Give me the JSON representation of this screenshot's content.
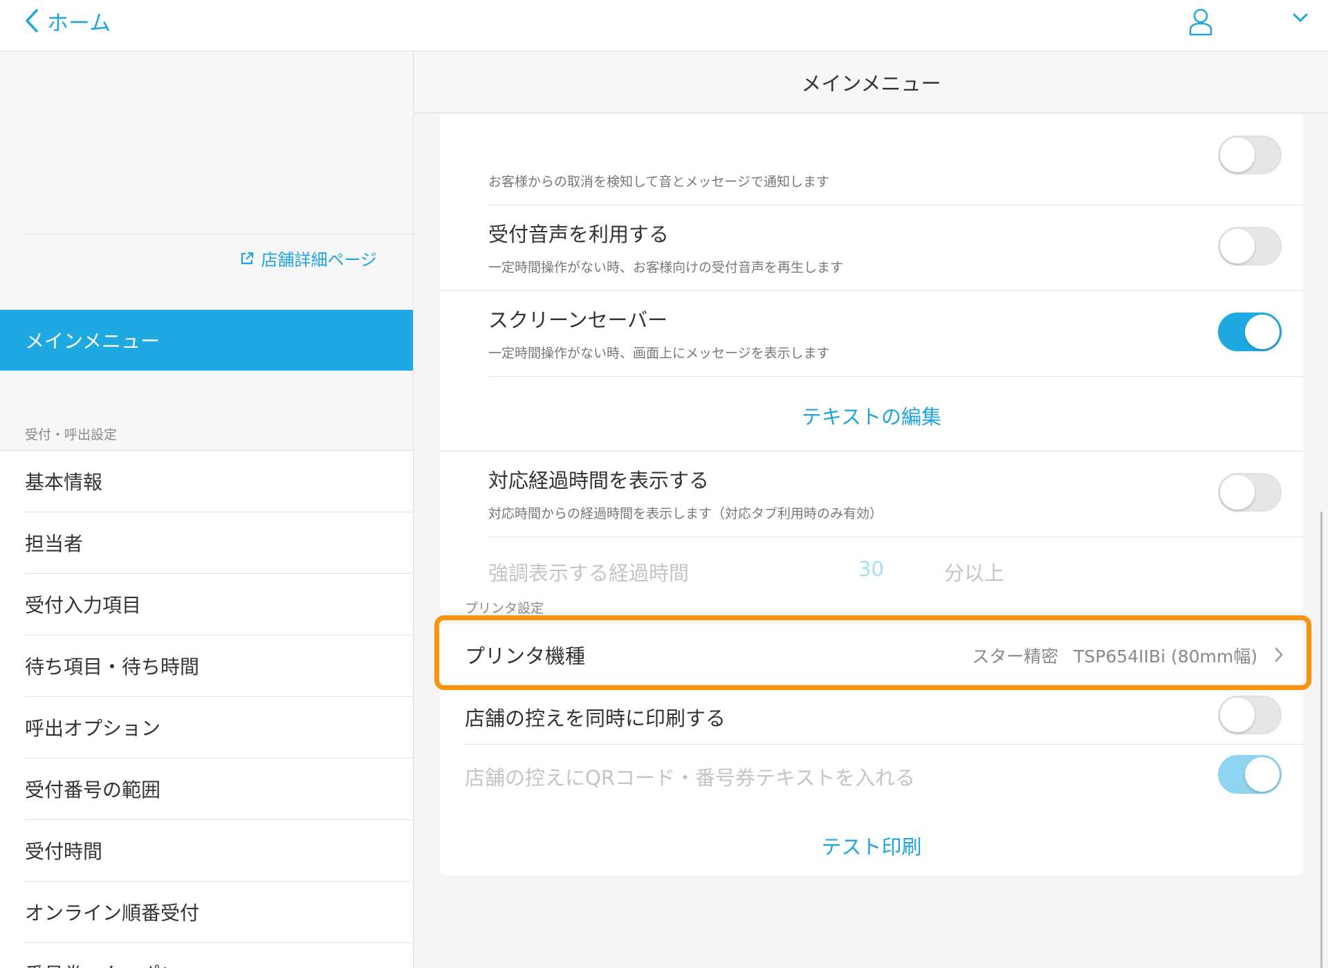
{
  "topbar": {
    "back_label": "ホーム"
  },
  "sidebar": {
    "store_link": "店舗詳細ページ",
    "active_item": "メインメニュー",
    "section_label": "受付・呼出設定",
    "items": [
      {
        "label": "基本情報"
      },
      {
        "label": "担当者"
      },
      {
        "label": "受付入力項目"
      },
      {
        "label": "待ち項目・待ち時間"
      },
      {
        "label": "呼出オプション"
      },
      {
        "label": "受付番号の範囲"
      },
      {
        "label": "受付時間"
      },
      {
        "label": "オンライン順番受付"
      },
      {
        "label": "番号券・クーポン"
      }
    ]
  },
  "main": {
    "header_title": "メインメニュー",
    "cancel_notice": {
      "subtitle": "お客様からの取消を検知して音とメッセージで通知します"
    },
    "reception_voice": {
      "title": "受付音声を利用する",
      "subtitle": "一定時間操作がない時、お客様向けの受付音声を再生します",
      "enabled": false
    },
    "screensaver": {
      "title": "スクリーンセーバー",
      "subtitle": "一定時間操作がない時、画面上にメッセージを表示します",
      "enabled": true
    },
    "edit_text_label": "テキストの編集",
    "elapsed_time": {
      "title": "対応経過時間を表示する",
      "subtitle": "対応時間からの経過時間を表示します（対応タブ利用時のみ有効）",
      "enabled": false
    },
    "highlight_elapsed": {
      "label": "強調表示する経過時間",
      "value": "30",
      "unit": "分以上"
    },
    "printer_section_label": "プリンタ設定",
    "printer_model": {
      "label": "プリンタ機種",
      "maker": "スター精密",
      "model": "TSP654IIBi (80mm幅)"
    },
    "store_copy": {
      "label": "店舗の控えを同時に印刷する",
      "enabled": false
    },
    "store_copy_qr": {
      "label": "店舗の控えにQRコード・番号券テキストを入れる",
      "enabled": true
    },
    "test_print_label": "テスト印刷"
  },
  "colors": {
    "accent": "#1fa9e3",
    "highlight": "#f7940e"
  }
}
